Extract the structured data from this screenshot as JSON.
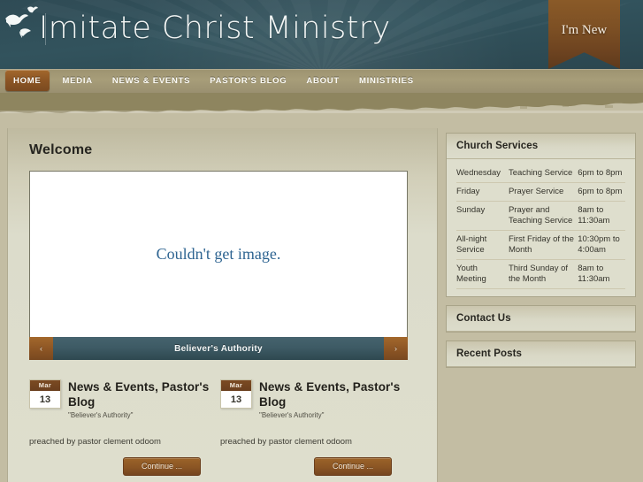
{
  "header": {
    "site_title": "Imitate Christ Ministry",
    "logo_icon": "doves-icon",
    "ribbon_label": "I'm New",
    "ribbon_color": "#7d5024",
    "background_color": "#32535d"
  },
  "nav": {
    "items": [
      {
        "label": "HOME",
        "active": true
      },
      {
        "label": "MEDIA",
        "active": false
      },
      {
        "label": "NEWS & EVENTS",
        "active": false
      },
      {
        "label": "PASTOR'S BLOG",
        "active": false
      },
      {
        "label": "ABOUT",
        "active": false
      },
      {
        "label": "MINISTRIES",
        "active": false
      }
    ],
    "active_color": "#8c5524",
    "bar_color": "#a79d79"
  },
  "main": {
    "page_title": "Welcome",
    "slider": {
      "image_error_text": "Couldn't get image.",
      "caption": "Believer's Authority",
      "prev_icon": "chevron-left-icon",
      "next_icon": "chevron-right-icon",
      "prev_label": "‹",
      "next_label": "›",
      "caption_color": "#3d5a64"
    },
    "posts": [
      {
        "date_month": "Mar",
        "date_day": "13",
        "title": "News & Events, Pastor's Blog",
        "subtitle": "\"Believer's Authority\"",
        "meta": "preached by pastor clement odoom",
        "continue_label": "Continue ..."
      },
      {
        "date_month": "Mar",
        "date_day": "13",
        "title": "News & Events, Pastor's Blog",
        "subtitle": "\"Believer's Authority\"",
        "meta": "preached by pastor clement odoom",
        "continue_label": "Continue ..."
      }
    ]
  },
  "sidebar": {
    "widgets": [
      {
        "title": "Church Services",
        "type": "table",
        "rows": [
          {
            "day": "Wednesday",
            "service": "Teaching Service",
            "time": "6pm to 8pm"
          },
          {
            "day": "Friday",
            "service": "Prayer Service",
            "time": "6pm to 8pm"
          },
          {
            "day": "Sunday",
            "service": "Prayer and Teaching Service",
            "time": "8am to 11:30am"
          },
          {
            "day": "All-night Service",
            "service": "First Friday of the Month",
            "time": "10:30pm to 4:00am"
          },
          {
            "day": "Youth Meeting",
            "service": "Third Sunday of the Month",
            "time": "8am to 11:30am"
          }
        ]
      },
      {
        "title": "Contact Us",
        "type": "collapsed",
        "rows": []
      },
      {
        "title": "Recent Posts",
        "type": "collapsed",
        "rows": []
      }
    ]
  },
  "theme": {
    "body_background": "#c3bda3",
    "panel_background": "#dedecd",
    "accent_brown": "#8c5524",
    "accent_teal": "#32535d",
    "link_blue": "#2e6491"
  }
}
